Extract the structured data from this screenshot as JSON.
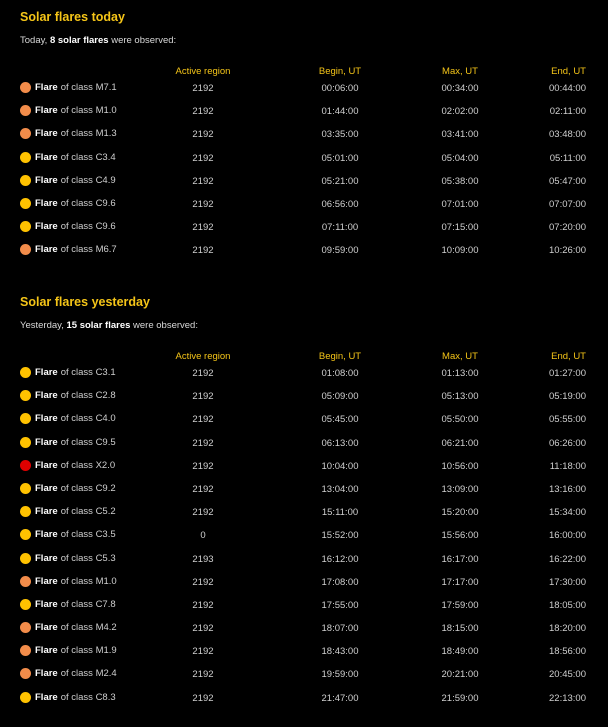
{
  "colors": {
    "accent": "#f5c518",
    "class_C": "#ffc200",
    "class_M": "#f28c4a",
    "class_X": "#e00000"
  },
  "columns": {
    "region": "Active region",
    "begin": "Begin, UT",
    "max": "Max, UT",
    "end": "End, UT"
  },
  "today": {
    "title": "Solar flares today",
    "summary_prefix": "Today,",
    "summary_count": "8 solar flares",
    "summary_suffix": "were observed:",
    "flares": [
      {
        "label": "Flare",
        "class_text": "of class M7.1",
        "level": "M",
        "region": "2192",
        "begin": "00:06:00",
        "max": "00:34:00",
        "end": "00:44:00"
      },
      {
        "label": "Flare",
        "class_text": "of class M1.0",
        "level": "M",
        "region": "2192",
        "begin": "01:44:00",
        "max": "02:02:00",
        "end": "02:11:00"
      },
      {
        "label": "Flare",
        "class_text": "of class M1.3",
        "level": "M",
        "region": "2192",
        "begin": "03:35:00",
        "max": "03:41:00",
        "end": "03:48:00"
      },
      {
        "label": "Flare",
        "class_text": "of class C3.4",
        "level": "C",
        "region": "2192",
        "begin": "05:01:00",
        "max": "05:04:00",
        "end": "05:11:00"
      },
      {
        "label": "Flare",
        "class_text": "of class C4.9",
        "level": "C",
        "region": "2192",
        "begin": "05:21:00",
        "max": "05:38:00",
        "end": "05:47:00"
      },
      {
        "label": "Flare",
        "class_text": "of class C9.6",
        "level": "C",
        "region": "2192",
        "begin": "06:56:00",
        "max": "07:01:00",
        "end": "07:07:00"
      },
      {
        "label": "Flare",
        "class_text": "of class C9.6",
        "level": "C",
        "region": "2192",
        "begin": "07:11:00",
        "max": "07:15:00",
        "end": "07:20:00"
      },
      {
        "label": "Flare",
        "class_text": "of class M6.7",
        "level": "M",
        "region": "2192",
        "begin": "09:59:00",
        "max": "10:09:00",
        "end": "10:26:00"
      }
    ]
  },
  "yesterday": {
    "title": "Solar flares yesterday",
    "summary_prefix": "Yesterday,",
    "summary_count": "15 solar flares",
    "summary_suffix": "were observed:",
    "flares": [
      {
        "label": "Flare",
        "class_text": "of class C3.1",
        "level": "C",
        "region": "2192",
        "begin": "01:08:00",
        "max": "01:13:00",
        "end": "01:27:00"
      },
      {
        "label": "Flare",
        "class_text": "of class C2.8",
        "level": "C",
        "region": "2192",
        "begin": "05:09:00",
        "max": "05:13:00",
        "end": "05:19:00"
      },
      {
        "label": "Flare",
        "class_text": "of class C4.0",
        "level": "C",
        "region": "2192",
        "begin": "05:45:00",
        "max": "05:50:00",
        "end": "05:55:00"
      },
      {
        "label": "Flare",
        "class_text": "of class C9.5",
        "level": "C",
        "region": "2192",
        "begin": "06:13:00",
        "max": "06:21:00",
        "end": "06:26:00"
      },
      {
        "label": "Flare",
        "class_text": "of class X2.0",
        "level": "X",
        "region": "2192",
        "begin": "10:04:00",
        "max": "10:56:00",
        "end": "11:18:00"
      },
      {
        "label": "Flare",
        "class_text": "of class C9.2",
        "level": "C",
        "region": "2192",
        "begin": "13:04:00",
        "max": "13:09:00",
        "end": "13:16:00"
      },
      {
        "label": "Flare",
        "class_text": "of class C5.2",
        "level": "C",
        "region": "2192",
        "begin": "15:11:00",
        "max": "15:20:00",
        "end": "15:34:00"
      },
      {
        "label": "Flare",
        "class_text": "of class C3.5",
        "level": "C",
        "region": "0",
        "begin": "15:52:00",
        "max": "15:56:00",
        "end": "16:00:00"
      },
      {
        "label": "Flare",
        "class_text": "of class C5.3",
        "level": "C",
        "region": "2193",
        "begin": "16:12:00",
        "max": "16:17:00",
        "end": "16:22:00"
      },
      {
        "label": "Flare",
        "class_text": "of class M1.0",
        "level": "M",
        "region": "2192",
        "begin": "17:08:00",
        "max": "17:17:00",
        "end": "17:30:00"
      },
      {
        "label": "Flare",
        "class_text": "of class C7.8",
        "level": "C",
        "region": "2192",
        "begin": "17:55:00",
        "max": "17:59:00",
        "end": "18:05:00"
      },
      {
        "label": "Flare",
        "class_text": "of class M4.2",
        "level": "M",
        "region": "2192",
        "begin": "18:07:00",
        "max": "18:15:00",
        "end": "18:20:00"
      },
      {
        "label": "Flare",
        "class_text": "of class M1.9",
        "level": "M",
        "region": "2192",
        "begin": "18:43:00",
        "max": "18:49:00",
        "end": "18:56:00"
      },
      {
        "label": "Flare",
        "class_text": "of class M2.4",
        "level": "M",
        "region": "2192",
        "begin": "19:59:00",
        "max": "20:21:00",
        "end": "20:45:00"
      },
      {
        "label": "Flare",
        "class_text": "of class C8.3",
        "level": "C",
        "region": "2192",
        "begin": "21:47:00",
        "max": "21:59:00",
        "end": "22:13:00"
      }
    ]
  }
}
